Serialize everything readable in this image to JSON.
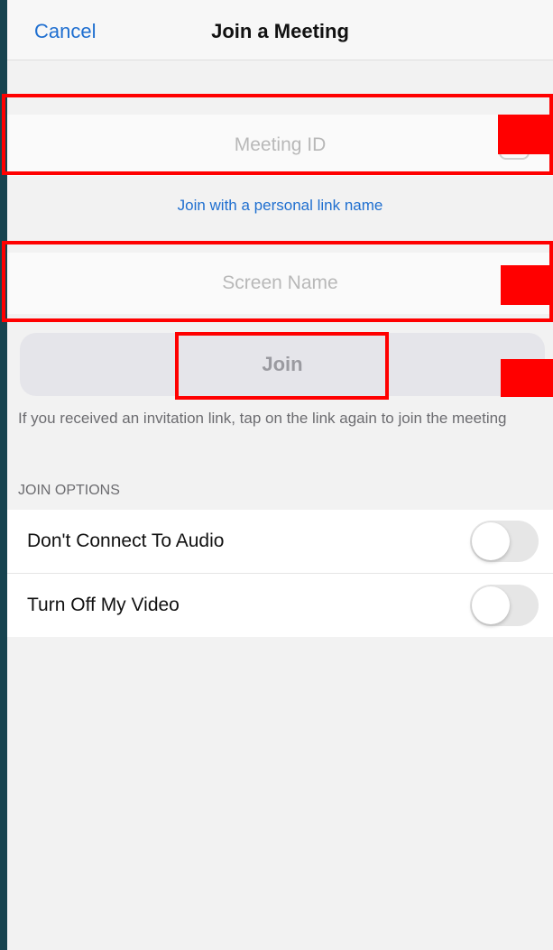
{
  "header": {
    "cancel_label": "Cancel",
    "title": "Join a Meeting"
  },
  "meeting_id": {
    "value": "",
    "placeholder": "Meeting ID",
    "dropdown_icon": "chevron-down-icon"
  },
  "personal_link_label": "Join with a personal link name",
  "screen_name": {
    "value": "",
    "placeholder": "Screen Name"
  },
  "join_button": {
    "label": "Join",
    "enabled": false
  },
  "hint_text": "If you received an invitation link, tap on the link again to join the meeting",
  "join_options": {
    "header": "JOIN OPTIONS",
    "items": [
      {
        "label": "Don't Connect To Audio",
        "on": false
      },
      {
        "label": "Turn Off My Video",
        "on": false
      }
    ]
  },
  "colors": {
    "accent_blue": "#1f6fd0",
    "annotation_red": "#ff0000",
    "background": "#f2f2f2"
  }
}
